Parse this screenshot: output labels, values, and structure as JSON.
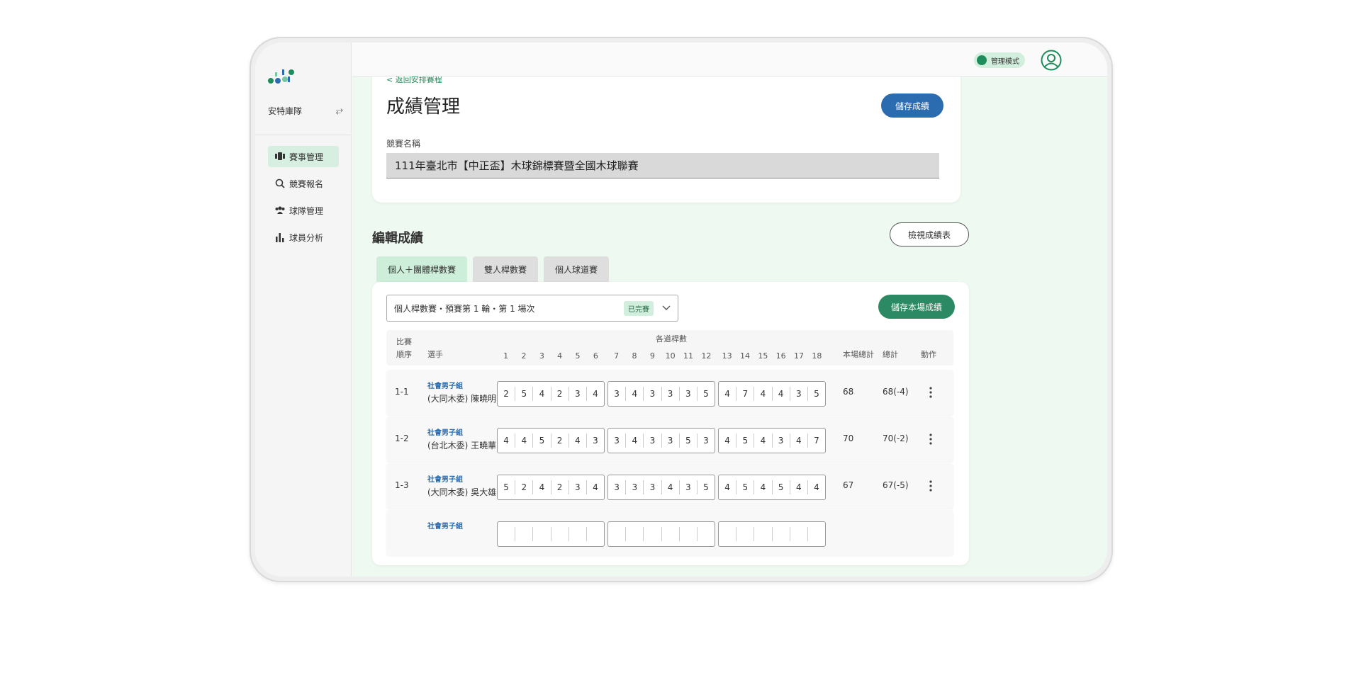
{
  "sidebar": {
    "team_name": "安特庫隊",
    "swap_icon": "⥂",
    "nav": [
      {
        "label": "賽事管理",
        "icon": "tournament-icon",
        "active": true
      },
      {
        "label": "競賽報名",
        "icon": "search-icon",
        "active": false
      },
      {
        "label": "球隊管理",
        "icon": "team-icon",
        "active": false
      },
      {
        "label": "球員分析",
        "icon": "bar-chart-icon",
        "active": false
      }
    ]
  },
  "topbar": {
    "mode_label": "管理模式"
  },
  "page": {
    "back_link": "< 返回安排賽程",
    "title": "成績管理",
    "save_button": "儲存成績",
    "name_label": "競賽名稱",
    "name_value": "111年臺北市【中正盃】木球錦標賽暨全國木球聯賽",
    "section_title": "編輯成績",
    "view_button": "檢視成績表"
  },
  "tabs": [
    {
      "label": "個人＋團體桿數賽",
      "active": true
    },
    {
      "label": "雙人桿數賽",
      "active": false
    },
    {
      "label": "個人球道賽",
      "active": false
    }
  ],
  "round": {
    "selected": "個人桿數賽・預賽第 1 輪・第 1 場次",
    "status": "已完賽",
    "save_button": "儲存本場成績"
  },
  "table": {
    "header": {
      "order_top": "比賽",
      "order_bottom": "順序",
      "player": "選手",
      "holes_title": "各道桿數",
      "holes": [
        "1",
        "2",
        "3",
        "4",
        "5",
        "6",
        "7",
        "8",
        "9",
        "10",
        "11",
        "12",
        "13",
        "14",
        "15",
        "16",
        "17",
        "18"
      ],
      "round_total": "本場總計",
      "grand_total": "總計",
      "action": "動作"
    },
    "rows": [
      {
        "order": "1-1",
        "group": "社會男子組",
        "player": "(大同木委) 陳曉明",
        "scores": [
          "2",
          "5",
          "4",
          "2",
          "3",
          "4",
          "3",
          "4",
          "3",
          "3",
          "3",
          "5",
          "4",
          "7",
          "4",
          "4",
          "3",
          "5"
        ],
        "total": "68",
        "grand": "68(-4)"
      },
      {
        "order": "1-2",
        "group": "社會男子組",
        "player": "(台北木委) 王曉華",
        "scores": [
          "4",
          "4",
          "5",
          "2",
          "4",
          "3",
          "3",
          "4",
          "3",
          "3",
          "5",
          "3",
          "4",
          "5",
          "4",
          "3",
          "4",
          "7"
        ],
        "total": "70",
        "grand": "70(-2)"
      },
      {
        "order": "1-3",
        "group": "社會男子組",
        "player": "(大同木委) 吳大雄",
        "scores": [
          "5",
          "2",
          "4",
          "2",
          "3",
          "4",
          "3",
          "3",
          "3",
          "4",
          "3",
          "5",
          "4",
          "5",
          "4",
          "5",
          "4",
          "4"
        ],
        "total": "67",
        "grand": "67(-5)"
      },
      {
        "order": "",
        "group": "社會男子組",
        "player": "",
        "scores": [
          "",
          "",
          "",
          "",
          "",
          "",
          "",
          "",
          "",
          "",
          "",
          "",
          "",
          "",
          "",
          "",
          "",
          ""
        ],
        "total": "",
        "grand": ""
      }
    ]
  }
}
